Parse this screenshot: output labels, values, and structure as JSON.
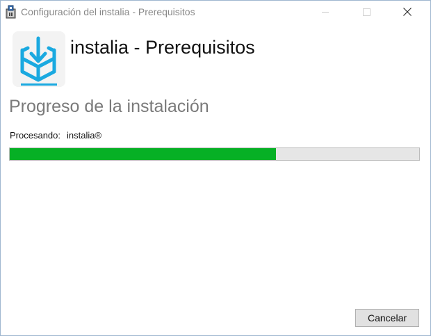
{
  "window": {
    "title": "Configuración del instalia - Prerequisitos",
    "app_icon": "installer-package-icon",
    "controls": {
      "minimize": "minimize-icon",
      "maximize": "maximize-icon",
      "close": "close-icon"
    }
  },
  "header": {
    "logo": "download-box-icon",
    "title": "instalia - Prerequisitos"
  },
  "main": {
    "section_title": "Progreso de la instalación",
    "status_label": "Procesando:",
    "status_value": "instalia®",
    "progress_fraction": 0.65,
    "progress_color": "#06b025"
  },
  "footer": {
    "cancel_label": "Cancelar"
  },
  "colors": {
    "logo_blue": "#1aa9e0",
    "title_gray": "#888888",
    "section_gray": "#7a7a7a"
  }
}
